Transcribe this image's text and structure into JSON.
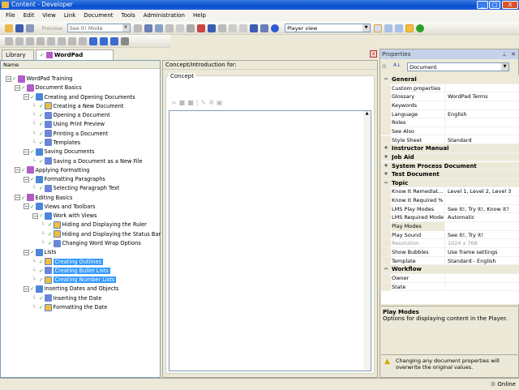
{
  "window": {
    "title": "Content - Developer"
  },
  "menu": [
    "File",
    "Edit",
    "View",
    "Link",
    "Document",
    "Tools",
    "Administration",
    "Help"
  ],
  "toolbar": {
    "preview_label": "Preview:",
    "preview_mode": "See It! Mode",
    "view_select": "Player view"
  },
  "tabs": [
    {
      "label": "Library"
    },
    {
      "label": "WordPad Training",
      "close": "X"
    }
  ],
  "outline": {
    "header": "Name",
    "items": [
      {
        "label": "WordPad Training",
        "depth": 0,
        "type": "book",
        "exp": "−"
      },
      {
        "label": "Document Basics",
        "depth": 1,
        "type": "book",
        "exp": "−"
      },
      {
        "label": "Creating and Opening Documents",
        "depth": 2,
        "type": "sect",
        "exp": "−"
      },
      {
        "label": "Creating a New Document",
        "depth": 3,
        "type": "topic"
      },
      {
        "label": "Opening a Document",
        "depth": 3,
        "type": "doc"
      },
      {
        "label": "Using Print Preview",
        "depth": 3,
        "type": "doc"
      },
      {
        "label": "Printing a Document",
        "depth": 3,
        "type": "doc"
      },
      {
        "label": "Templates",
        "depth": 3,
        "type": "doc"
      },
      {
        "label": "Saving Documents",
        "depth": 2,
        "type": "sect",
        "exp": "−"
      },
      {
        "label": "Saving a Document as a New File",
        "depth": 3,
        "type": "doc"
      },
      {
        "label": "Applying Formatting",
        "depth": 1,
        "type": "book",
        "exp": "−"
      },
      {
        "label": "Formatting Paragraphs",
        "depth": 2,
        "type": "sect",
        "exp": "−"
      },
      {
        "label": "Selecting Paragraph Text",
        "depth": 3,
        "type": "doc"
      },
      {
        "label": "Editing Basics",
        "depth": 1,
        "type": "book",
        "exp": "−"
      },
      {
        "label": "Views and Toolbars",
        "depth": 2,
        "type": "sect",
        "exp": "−"
      },
      {
        "label": "Work with Views",
        "depth": 3,
        "type": "sect",
        "exp": "−"
      },
      {
        "label": "Hiding and Displaying the Ruler",
        "depth": 4,
        "type": "topic"
      },
      {
        "label": "Hiding and Displaying the Status Bar",
        "depth": 4,
        "type": "topic"
      },
      {
        "label": "Changing Word Wrap Options",
        "depth": 4,
        "type": "doc"
      },
      {
        "label": "Lists",
        "depth": 2,
        "type": "sect",
        "exp": "−"
      },
      {
        "label": "Creating Outlines",
        "depth": 3,
        "type": "topic",
        "selected": true
      },
      {
        "label": "Creating Bullet Lists",
        "depth": 3,
        "type": "doc",
        "selected": true
      },
      {
        "label": "Creating Number Lists",
        "depth": 3,
        "type": "topic",
        "selected": true
      },
      {
        "label": "Inserting Dates and Objects",
        "depth": 2,
        "type": "sect",
        "exp": "−"
      },
      {
        "label": "Inserting the Date",
        "depth": 3,
        "type": "doc"
      },
      {
        "label": "Formatting the Date",
        "depth": 3,
        "type": "topic"
      }
    ]
  },
  "concept": {
    "header": "Concept/Introduction for:",
    "group": "Concept"
  },
  "properties": {
    "title": "Properties",
    "object": "Document",
    "rows": [
      {
        "cat": "General",
        "exp": "−"
      },
      {
        "k": "Custom properties",
        "v": ""
      },
      {
        "k": "Glossary",
        "v": "WordPad Terms"
      },
      {
        "k": "Keywords",
        "v": ""
      },
      {
        "k": "Language",
        "v": "English"
      },
      {
        "k": "Roles",
        "v": ""
      },
      {
        "k": "See Also",
        "v": ""
      },
      {
        "k": "Style Sheet",
        "v": "Standard"
      },
      {
        "cat": "Instructor Manual",
        "exp": "+"
      },
      {
        "cat": "Job Aid",
        "exp": "+"
      },
      {
        "cat": "System Process Document",
        "exp": "+"
      },
      {
        "cat": "Test Document",
        "exp": "+"
      },
      {
        "cat": "Topic",
        "exp": "−"
      },
      {
        "k": "Know It Remediat...",
        "v": "Level 1, Level 2, Level 3"
      },
      {
        "k": "Know It Required %",
        "v": ""
      },
      {
        "k": "LMS Play Modes",
        "v": "See It!, Try It!, Know It?"
      },
      {
        "k": "LMS Required Mode",
        "v": "Automatic"
      },
      {
        "k": "Play Modes",
        "v": "",
        "hl": true
      },
      {
        "k": "Play Sound",
        "v": "See It!, Try It!"
      },
      {
        "k": "Resolution",
        "v": "1024 x 768",
        "dis": true
      },
      {
        "k": "Show Bubbles",
        "v": "Use frame settings"
      },
      {
        "k": "Template",
        "v": "Standard - English"
      },
      {
        "cat": "Workflow",
        "exp": "−"
      },
      {
        "k": "Owner",
        "v": ""
      },
      {
        "k": "State",
        "v": ""
      }
    ],
    "desc_title": "Play Modes",
    "desc_text": "Options for displaying content in the Player.",
    "warning": "Changing any document properties will overwrite the original values."
  },
  "status": {
    "text": "Online"
  }
}
